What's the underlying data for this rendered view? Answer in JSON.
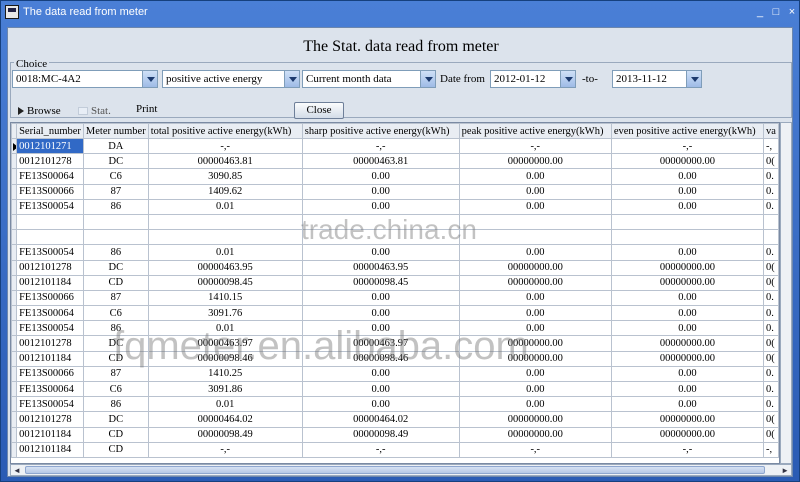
{
  "window": {
    "title": "The data read from meter",
    "controls": {
      "minimize": "_",
      "maximize": "□",
      "close": "×"
    }
  },
  "heading": "The Stat. data read from meter",
  "choice": {
    "group_label": "Choice",
    "meter": "0018:MC-4A2",
    "energy_type": "positive active energy",
    "period": "Current month data",
    "date_from_label": "Date from",
    "date_from": "2012-01-12",
    "to_label": "-to-",
    "date_to": "2013-11-12"
  },
  "toolbar": {
    "browse": "Browse",
    "stat": "Stat.",
    "print": "Print",
    "close": "Close"
  },
  "table": {
    "columns": [
      "Serial_number",
      "Meter number",
      "total positive active energy(kWh)",
      "sharp positive active energy(kWh)",
      "peak positive active energy(kWh)",
      "even positive active energy(kWh)",
      "va"
    ],
    "rows": [
      [
        "0012101271",
        "DA",
        "-,-",
        "-,-",
        "-,-",
        "-,-",
        "-,"
      ],
      [
        "0012101278",
        "DC",
        "00000463.81",
        "00000463.81",
        "00000000.00",
        "00000000.00",
        "0("
      ],
      [
        "FE13S00064",
        "C6",
        "3090.85",
        "0.00",
        "0.00",
        "0.00",
        "0."
      ],
      [
        "FE13S00066",
        "87",
        "1409.62",
        "0.00",
        "0.00",
        "0.00",
        "0."
      ],
      [
        "FE13S00054",
        "86",
        "0.01",
        "0.00",
        "0.00",
        "0.00",
        "0."
      ],
      [
        "",
        "",
        "",
        "",
        "",
        "",
        ""
      ],
      [
        "",
        "",
        "",
        "",
        "",
        "",
        ""
      ],
      [
        "FE13S00054",
        "86",
        "0.01",
        "0.00",
        "0.00",
        "0.00",
        "0."
      ],
      [
        "0012101278",
        "DC",
        "00000463.95",
        "00000463.95",
        "00000000.00",
        "00000000.00",
        "0("
      ],
      [
        "0012101184",
        "CD",
        "00000098.45",
        "00000098.45",
        "00000000.00",
        "00000000.00",
        "0("
      ],
      [
        "FE13S00066",
        "87",
        "1410.15",
        "0.00",
        "0.00",
        "0.00",
        "0."
      ],
      [
        "FE13S00064",
        "C6",
        "3091.76",
        "0.00",
        "0.00",
        "0.00",
        "0."
      ],
      [
        "FE13S00054",
        "86",
        "0.01",
        "0.00",
        "0.00",
        "0.00",
        "0."
      ],
      [
        "0012101278",
        "DC",
        "00000463.97",
        "00000463.97",
        "00000000.00",
        "00000000.00",
        "0("
      ],
      [
        "0012101184",
        "CD",
        "00000098.46",
        "00000098.46",
        "00000000.00",
        "00000000.00",
        "0("
      ],
      [
        "FE13S00066",
        "87",
        "1410.25",
        "0.00",
        "0.00",
        "0.00",
        "0."
      ],
      [
        "FE13S00064",
        "C6",
        "3091.86",
        "0.00",
        "0.00",
        "0.00",
        "0."
      ],
      [
        "FE13S00054",
        "86",
        "0.01",
        "0.00",
        "0.00",
        "0.00",
        "0."
      ],
      [
        "0012101278",
        "DC",
        "00000464.02",
        "00000464.02",
        "00000000.00",
        "00000000.00",
        "0("
      ],
      [
        "0012101184",
        "CD",
        "00000098.49",
        "00000098.49",
        "00000000.00",
        "00000000.00",
        "0("
      ],
      [
        "0012101184",
        "CD",
        "-,-",
        "-,-",
        "-,-",
        "-,-",
        "-,"
      ]
    ]
  },
  "watermarks": [
    "trade.china.cn",
    "fqmeter.en.alibaba.com"
  ],
  "colors": {
    "selection": "#3169c6",
    "titlebar": "#2a5bb4"
  }
}
